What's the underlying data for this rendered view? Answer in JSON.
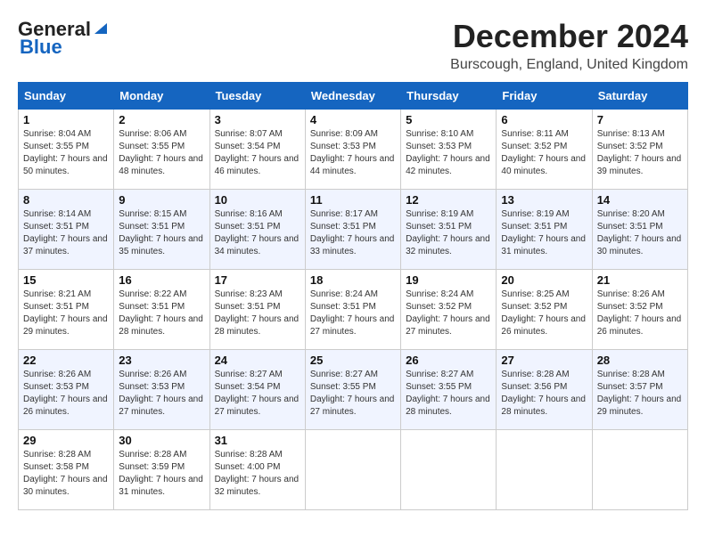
{
  "header": {
    "logo_general": "General",
    "logo_blue": "Blue",
    "month_title": "December 2024",
    "location": "Burscough, England, United Kingdom"
  },
  "calendar": {
    "days_of_week": [
      "Sunday",
      "Monday",
      "Tuesday",
      "Wednesday",
      "Thursday",
      "Friday",
      "Saturday"
    ],
    "weeks": [
      [
        null,
        {
          "day": "2",
          "sunrise": "Sunrise: 8:06 AM",
          "sunset": "Sunset: 3:55 PM",
          "daylight": "Daylight: 7 hours and 48 minutes."
        },
        {
          "day": "3",
          "sunrise": "Sunrise: 8:07 AM",
          "sunset": "Sunset: 3:54 PM",
          "daylight": "Daylight: 7 hours and 46 minutes."
        },
        {
          "day": "4",
          "sunrise": "Sunrise: 8:09 AM",
          "sunset": "Sunset: 3:53 PM",
          "daylight": "Daylight: 7 hours and 44 minutes."
        },
        {
          "day": "5",
          "sunrise": "Sunrise: 8:10 AM",
          "sunset": "Sunset: 3:53 PM",
          "daylight": "Daylight: 7 hours and 42 minutes."
        },
        {
          "day": "6",
          "sunrise": "Sunrise: 8:11 AM",
          "sunset": "Sunset: 3:52 PM",
          "daylight": "Daylight: 7 hours and 40 minutes."
        },
        {
          "day": "7",
          "sunrise": "Sunrise: 8:13 AM",
          "sunset": "Sunset: 3:52 PM",
          "daylight": "Daylight: 7 hours and 39 minutes."
        }
      ],
      [
        {
          "day": "8",
          "sunrise": "Sunrise: 8:14 AM",
          "sunset": "Sunset: 3:51 PM",
          "daylight": "Daylight: 7 hours and 37 minutes."
        },
        {
          "day": "9",
          "sunrise": "Sunrise: 8:15 AM",
          "sunset": "Sunset: 3:51 PM",
          "daylight": "Daylight: 7 hours and 35 minutes."
        },
        {
          "day": "10",
          "sunrise": "Sunrise: 8:16 AM",
          "sunset": "Sunset: 3:51 PM",
          "daylight": "Daylight: 7 hours and 34 minutes."
        },
        {
          "day": "11",
          "sunrise": "Sunrise: 8:17 AM",
          "sunset": "Sunset: 3:51 PM",
          "daylight": "Daylight: 7 hours and 33 minutes."
        },
        {
          "day": "12",
          "sunrise": "Sunrise: 8:19 AM",
          "sunset": "Sunset: 3:51 PM",
          "daylight": "Daylight: 7 hours and 32 minutes."
        },
        {
          "day": "13",
          "sunrise": "Sunrise: 8:19 AM",
          "sunset": "Sunset: 3:51 PM",
          "daylight": "Daylight: 7 hours and 31 minutes."
        },
        {
          "day": "14",
          "sunrise": "Sunrise: 8:20 AM",
          "sunset": "Sunset: 3:51 PM",
          "daylight": "Daylight: 7 hours and 30 minutes."
        }
      ],
      [
        {
          "day": "15",
          "sunrise": "Sunrise: 8:21 AM",
          "sunset": "Sunset: 3:51 PM",
          "daylight": "Daylight: 7 hours and 29 minutes."
        },
        {
          "day": "16",
          "sunrise": "Sunrise: 8:22 AM",
          "sunset": "Sunset: 3:51 PM",
          "daylight": "Daylight: 7 hours and 28 minutes."
        },
        {
          "day": "17",
          "sunrise": "Sunrise: 8:23 AM",
          "sunset": "Sunset: 3:51 PM",
          "daylight": "Daylight: 7 hours and 28 minutes."
        },
        {
          "day": "18",
          "sunrise": "Sunrise: 8:24 AM",
          "sunset": "Sunset: 3:51 PM",
          "daylight": "Daylight: 7 hours and 27 minutes."
        },
        {
          "day": "19",
          "sunrise": "Sunrise: 8:24 AM",
          "sunset": "Sunset: 3:52 PM",
          "daylight": "Daylight: 7 hours and 27 minutes."
        },
        {
          "day": "20",
          "sunrise": "Sunrise: 8:25 AM",
          "sunset": "Sunset: 3:52 PM",
          "daylight": "Daylight: 7 hours and 26 minutes."
        },
        {
          "day": "21",
          "sunrise": "Sunrise: 8:26 AM",
          "sunset": "Sunset: 3:52 PM",
          "daylight": "Daylight: 7 hours and 26 minutes."
        }
      ],
      [
        {
          "day": "22",
          "sunrise": "Sunrise: 8:26 AM",
          "sunset": "Sunset: 3:53 PM",
          "daylight": "Daylight: 7 hours and 26 minutes."
        },
        {
          "day": "23",
          "sunrise": "Sunrise: 8:26 AM",
          "sunset": "Sunset: 3:53 PM",
          "daylight": "Daylight: 7 hours and 27 minutes."
        },
        {
          "day": "24",
          "sunrise": "Sunrise: 8:27 AM",
          "sunset": "Sunset: 3:54 PM",
          "daylight": "Daylight: 7 hours and 27 minutes."
        },
        {
          "day": "25",
          "sunrise": "Sunrise: 8:27 AM",
          "sunset": "Sunset: 3:55 PM",
          "daylight": "Daylight: 7 hours and 27 minutes."
        },
        {
          "day": "26",
          "sunrise": "Sunrise: 8:27 AM",
          "sunset": "Sunset: 3:55 PM",
          "daylight": "Daylight: 7 hours and 28 minutes."
        },
        {
          "day": "27",
          "sunrise": "Sunrise: 8:28 AM",
          "sunset": "Sunset: 3:56 PM",
          "daylight": "Daylight: 7 hours and 28 minutes."
        },
        {
          "day": "28",
          "sunrise": "Sunrise: 8:28 AM",
          "sunset": "Sunset: 3:57 PM",
          "daylight": "Daylight: 7 hours and 29 minutes."
        }
      ],
      [
        {
          "day": "29",
          "sunrise": "Sunrise: 8:28 AM",
          "sunset": "Sunset: 3:58 PM",
          "daylight": "Daylight: 7 hours and 30 minutes."
        },
        {
          "day": "30",
          "sunrise": "Sunrise: 8:28 AM",
          "sunset": "Sunset: 3:59 PM",
          "daylight": "Daylight: 7 hours and 31 minutes."
        },
        {
          "day": "31",
          "sunrise": "Sunrise: 8:28 AM",
          "sunset": "Sunset: 4:00 PM",
          "daylight": "Daylight: 7 hours and 32 minutes."
        },
        null,
        null,
        null,
        null
      ]
    ],
    "week1_day1": {
      "day": "1",
      "sunrise": "Sunrise: 8:04 AM",
      "sunset": "Sunset: 3:55 PM",
      "daylight": "Daylight: 7 hours and 50 minutes."
    }
  }
}
